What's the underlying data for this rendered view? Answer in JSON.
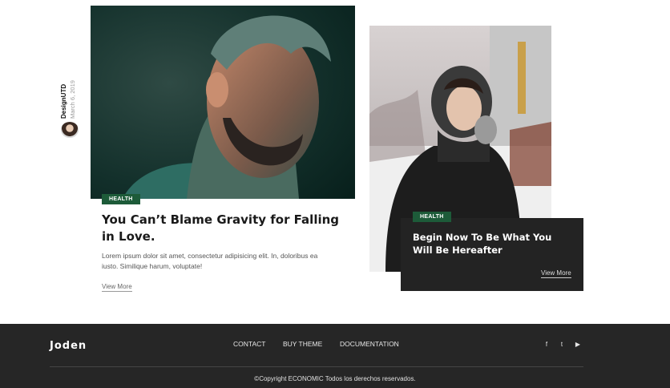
{
  "author": {
    "name": "DesignUTD",
    "date": "March 6, 2019"
  },
  "posts": [
    {
      "category": "HEALTH",
      "title": "You Can’t Blame Gravity for Falling in Love.",
      "excerpt": "Lorem ipsum dolor sit amet, consectetur adipisicing elit. In, doloribus ea iusto. Similique harum, voluptate!",
      "link_label": "View More",
      "image_alt": "photo"
    },
    {
      "category": "HEALTH",
      "title": "Begin Now To Be What You Will Be Hereafter",
      "link_label": "View More",
      "image_alt": "photo"
    }
  ],
  "footer": {
    "logo": "Joden",
    "nav": [
      "CONTACT",
      "BUY THEME",
      "DOCUMENTATION"
    ],
    "social": [
      {
        "icon": "facebook-icon",
        "glyph": "f"
      },
      {
        "icon": "twitter-icon",
        "glyph": "t"
      },
      {
        "icon": "youtube-icon",
        "glyph": "▶"
      }
    ],
    "copyright": "©Copyright ECONOMIC Todos los derechos reservados."
  },
  "colors": {
    "tag": "#1d5b39",
    "card": "#232323",
    "footer": "#262626"
  }
}
